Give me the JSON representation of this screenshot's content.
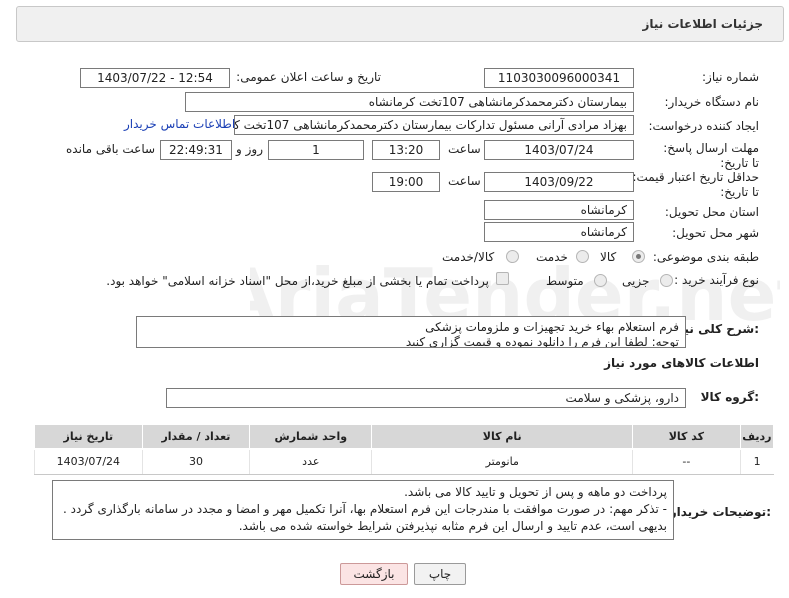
{
  "header": {
    "title": "جزئیات اطلاعات نیاز"
  },
  "fields": {
    "need_number": {
      "label": "شماره نیاز:",
      "value": "1103030096000341"
    },
    "announce_datetime": {
      "label": "تاریخ و ساعت اعلان عمومی:",
      "value": "1403/07/22 - 12:54"
    },
    "buyer_org": {
      "label": "نام دستگاه خریدار:",
      "value": "بیمارستان دکترمحمدکرمانشاهی 107تخت کرمانشاه"
    },
    "creator": {
      "label": "ایجاد کننده درخواست:",
      "value": "بهزاد مرادی آرانی مسئول تدارکات بیمارستان دکترمحمدکرمانشاهی 107تخت کر",
      "contact_link": "اطلاعات تماس خریدار"
    },
    "deadline": {
      "label": "مهلت ارسال پاسخ: تا تاریخ:",
      "date": "1403/07/24",
      "time_label": "ساعت",
      "time": "13:20",
      "days": "1",
      "days_label": "روز و",
      "remaining": "22:49:31",
      "remaining_label": "ساعت باقی مانده"
    },
    "price_validity": {
      "label": "حداقل تاریخ اعتبار قیمت: تا تاریخ:",
      "date": "1403/09/22",
      "time_label": "ساعت",
      "time": "19:00"
    },
    "province": {
      "label": "استان محل تحویل:",
      "value": "کرمانشاه"
    },
    "city": {
      "label": "شهر محل تحویل:",
      "value": "کرمانشاه"
    },
    "category": {
      "label": "طبقه بندی موضوعی:",
      "options": [
        "کالا",
        "خدمت",
        "کالا/خدمت"
      ],
      "selected": "کالا"
    },
    "purchase_type": {
      "label": "نوع فرآیند خرید :",
      "options": [
        "جزیی",
        "متوسط"
      ],
      "selected": "",
      "payment_note": "پرداخت تمام یا بخشی از مبلغ خرید،از محل \"اسناد خزانه اسلامی\" خواهد بود."
    }
  },
  "general_description": {
    "label": "شرح کلی نیاز:",
    "lines": [
      "فرم استعلام بهاء خرید تجهیزات و ملزومات پزشکی",
      "توجه: لطفا این فرم را دانلود نموده و قیمت گزاری کنید"
    ]
  },
  "items_section": {
    "title": "اطلاعات کالاهای مورد نیاز",
    "group_label": "گروه کالا:",
    "group_value": "دارو، پزشکی و سلامت"
  },
  "table": {
    "headers": [
      "ردیف",
      "کد کالا",
      "نام کالا",
      "واحد شمارش",
      "تعداد / مقدار",
      "تاریخ نیاز"
    ],
    "rows": [
      [
        "1",
        "--",
        "مانومتر",
        "عدد",
        "30",
        "1403/07/24"
      ]
    ]
  },
  "buyer_notes": {
    "label": "توضیحات خریدار:",
    "lines": [
      "پرداخت دو ماهه  و پس از تحویل و تایید کالا می باشد.",
      "- تذکر مهم: در صورت موافقت با مندرجات این فرم استعلام بها، آنرا تکمیل  مهر و امضا و مجدد در سامانه بارگذاری گردد .",
      "بدیهی است، عدم تایید و ارسال این فرم مثابه نپذیرفتن شرایط خواسته شده می باشد."
    ]
  },
  "buttons": {
    "print": "چاپ",
    "back": "بازگشت"
  },
  "watermark": {
    "text": "AriaTender.net"
  }
}
